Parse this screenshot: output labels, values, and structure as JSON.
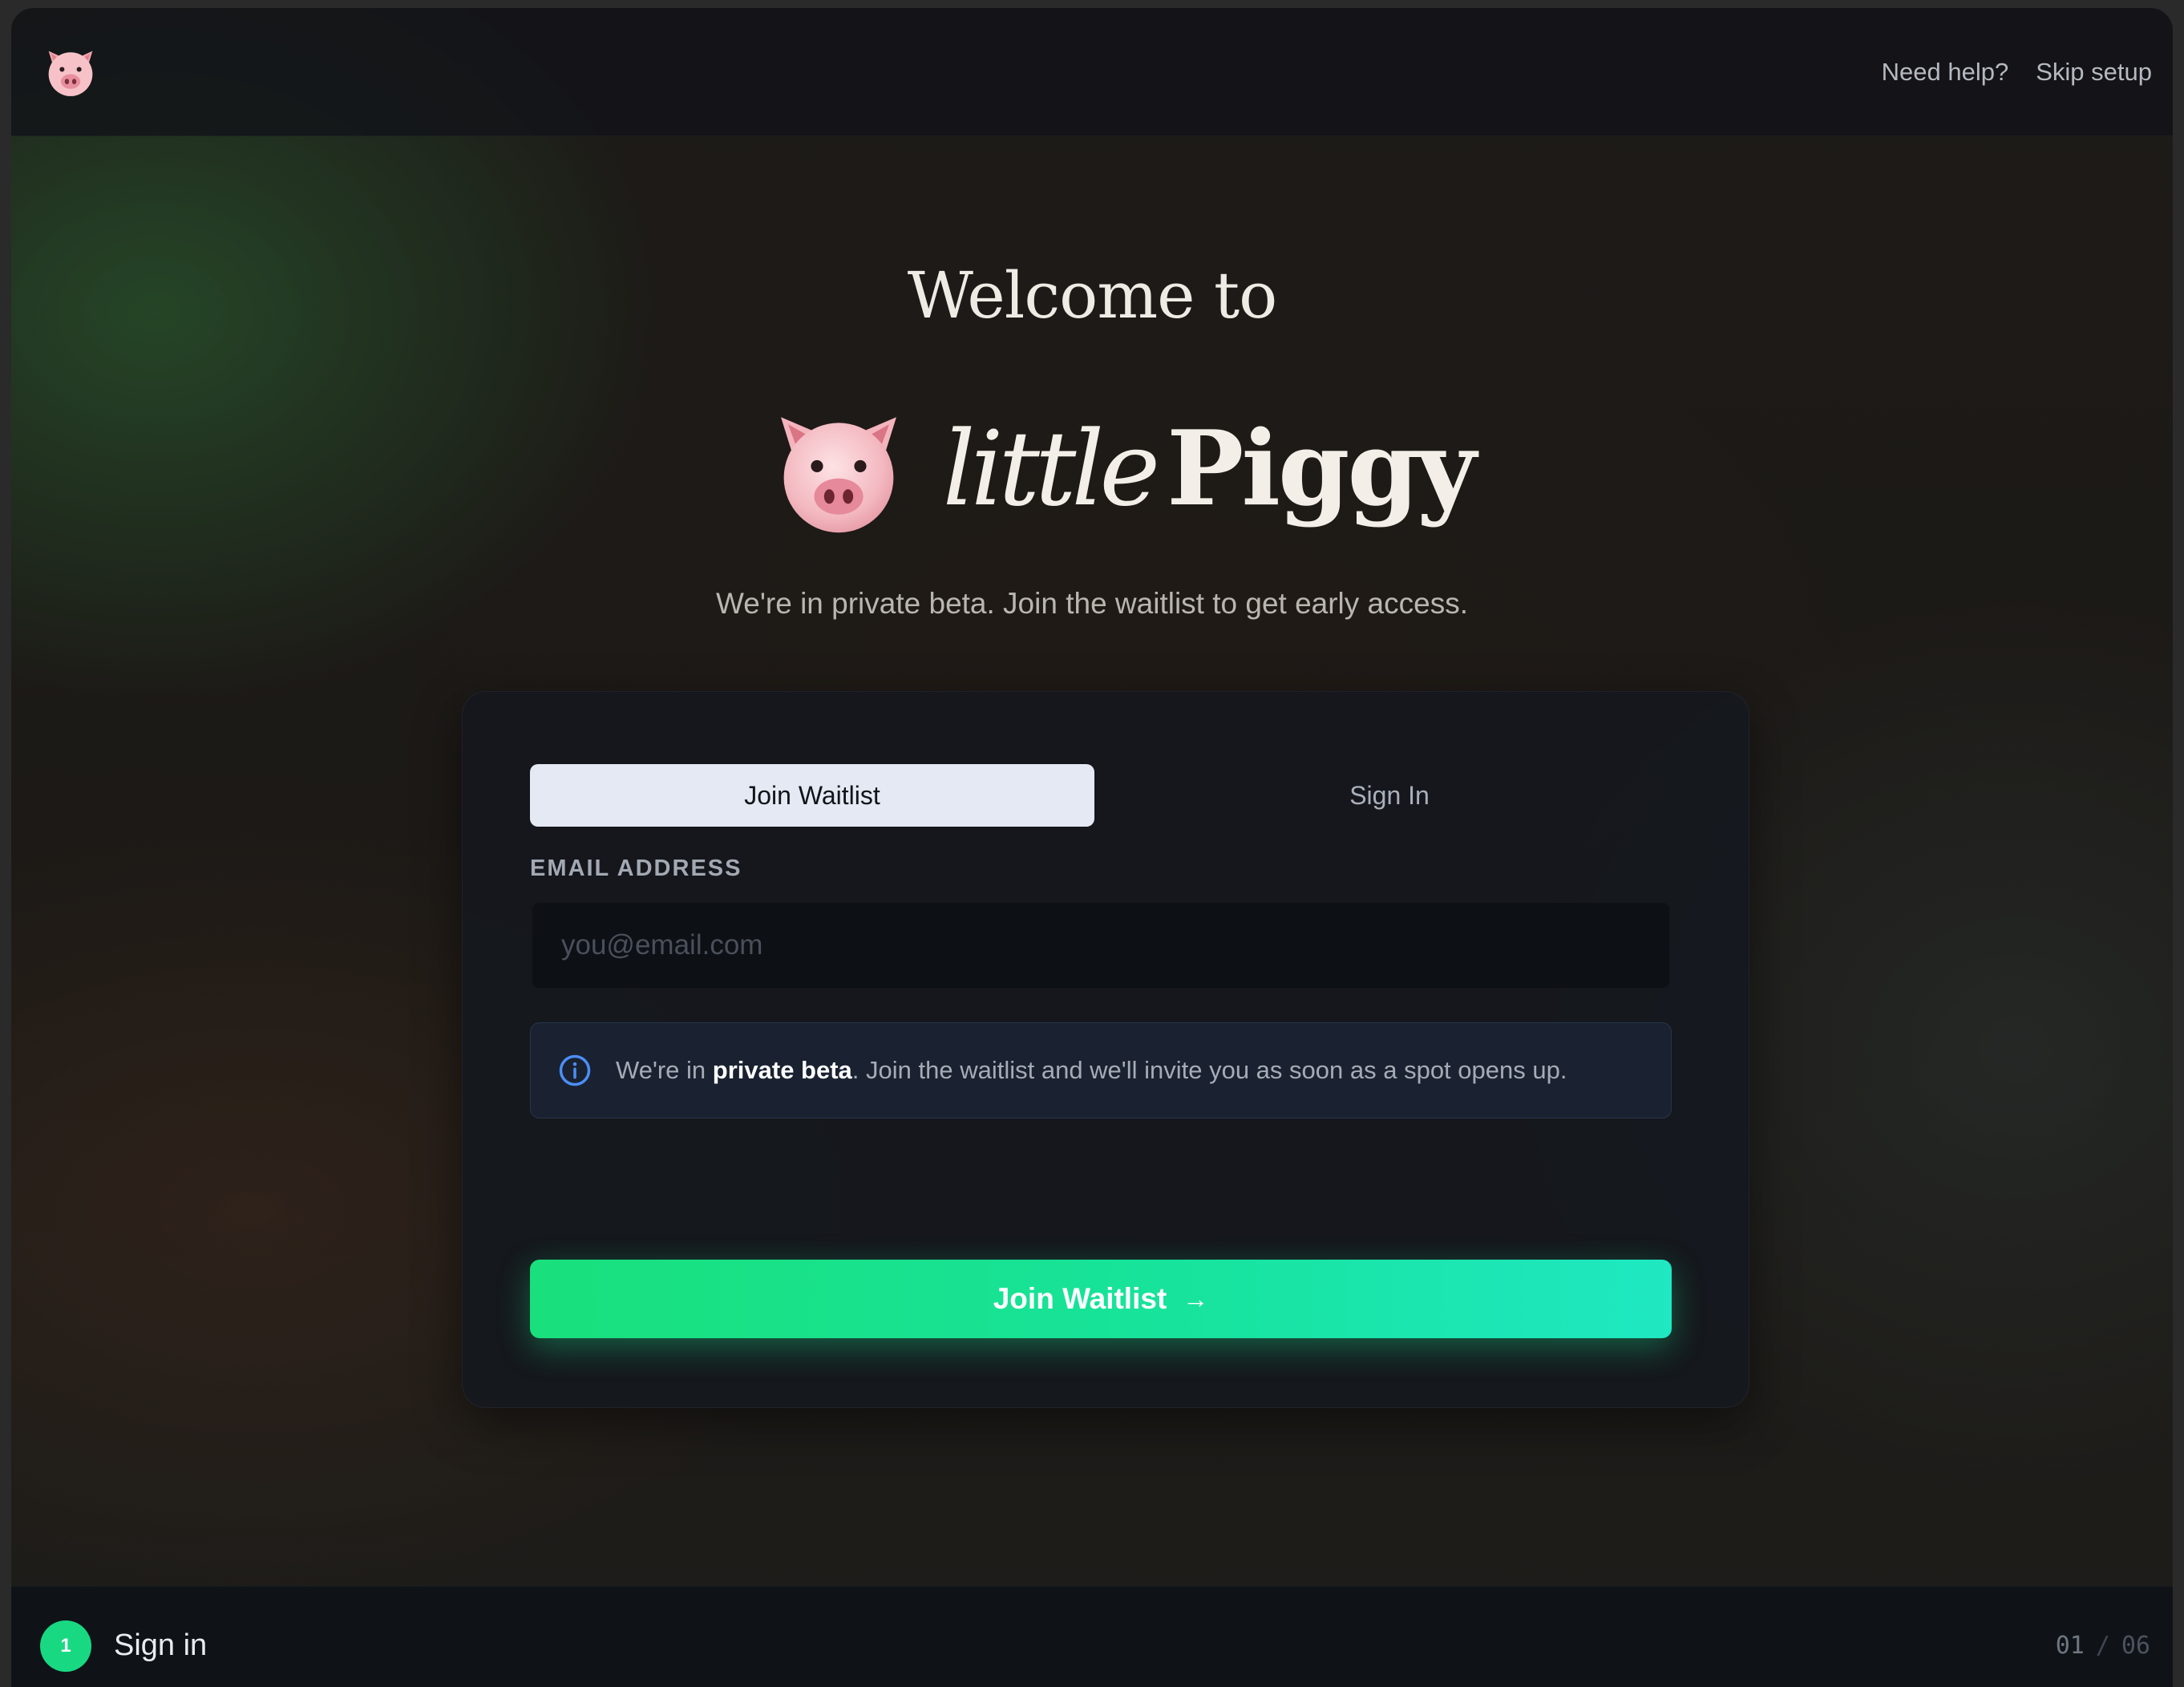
{
  "header": {
    "logo_icon": "pig-face-icon",
    "need_help": "Need help?",
    "skip_setup": "Skip setup"
  },
  "hero": {
    "welcome": "Welcome to",
    "brand_icon": "pig-face-icon",
    "brand_little": "little",
    "brand_piggy": "Piggy",
    "tagline": "We're in private beta. Join the waitlist to get early access."
  },
  "card": {
    "tabs": [
      {
        "label": "Join Waitlist",
        "active": true
      },
      {
        "label": "Sign In",
        "active": false
      }
    ],
    "email_label": "EMAIL ADDRESS",
    "email_value": "",
    "email_placeholder": "you@email.com",
    "notice": {
      "icon": "info-icon",
      "prefix": "We're in ",
      "bold": "private beta",
      "suffix": ". Join the waitlist and we'll invite you as soon as a spot opens up."
    },
    "cta_label": "Join Waitlist",
    "cta_icon": "arrow-right-icon"
  },
  "footer": {
    "step_number": "1",
    "step_label": "Sign in",
    "step_current": "01",
    "step_separator": "/",
    "step_total": "06"
  },
  "colors": {
    "accent_green": "#18d982",
    "cta_gradient_start": "#19e07c",
    "cta_gradient_end": "#1fe8c2",
    "info_blue": "#4c8ef7",
    "tab_active_bg": "#e4e9f3"
  }
}
